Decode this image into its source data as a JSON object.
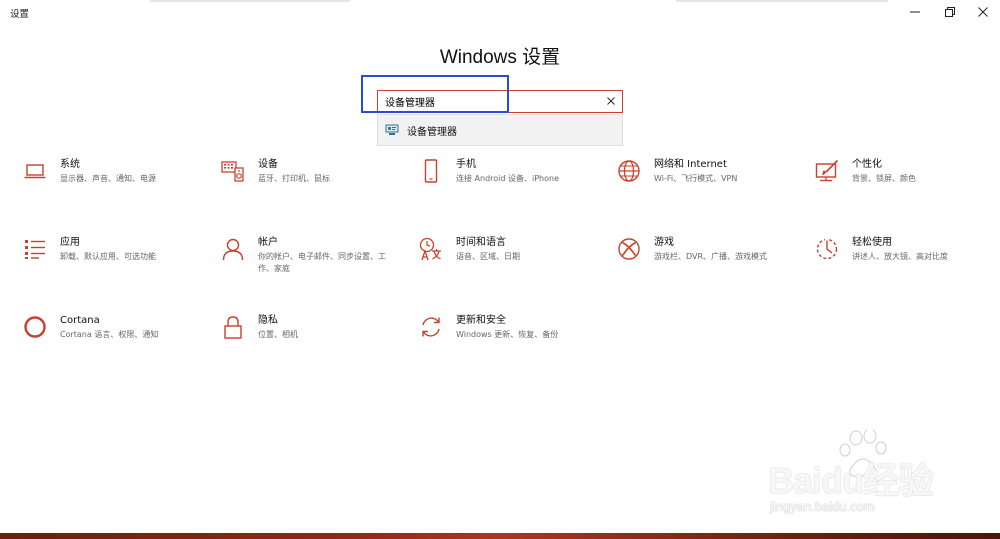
{
  "window": {
    "app_title": "设置",
    "controls": {
      "minimize": "minimize-icon",
      "maximize": "restore-icon",
      "close": "close-icon"
    }
  },
  "page_title": "Windows 设置",
  "search": {
    "value": "设备管理器",
    "placeholder": "",
    "clear_icon": "close-icon",
    "suggestion": {
      "label": "设备管理器",
      "icon": "device-manager-icon"
    }
  },
  "accent_color": "#c8412c",
  "focus_color": "#2b4bd6",
  "tiles": [
    {
      "name": "系统",
      "desc": "显示器、声音、通知、电源",
      "icon": "laptop-icon"
    },
    {
      "name": "设备",
      "desc": "蓝牙、打印机、鼠标",
      "icon": "keyboard-speaker-icon"
    },
    {
      "name": "手机",
      "desc": "连接 Android 设备、iPhone",
      "icon": "phone-icon"
    },
    {
      "name": "网络和 Internet",
      "desc": "Wi-Fi、飞行模式、VPN",
      "icon": "globe-icon"
    },
    {
      "name": "个性化",
      "desc": "背景、锁屏、颜色",
      "icon": "paint-monitor-icon"
    },
    {
      "name": "应用",
      "desc": "卸载、默认应用、可选功能",
      "icon": "app-list-icon"
    },
    {
      "name": "帐户",
      "desc": "你的帐户、电子邮件、同步设置、工作、家庭",
      "icon": "person-icon"
    },
    {
      "name": "时间和语言",
      "desc": "语音、区域、日期",
      "icon": "time-language-icon"
    },
    {
      "name": "游戏",
      "desc": "游戏栏、DVR、广播、游戏模式",
      "icon": "xbox-icon"
    },
    {
      "name": "轻松使用",
      "desc": "讲述人、放大镜、高对比度",
      "icon": "ease-of-access-icon"
    },
    {
      "name": "Cortana",
      "desc": "Cortana 语言、权限、通知",
      "icon": "cortana-icon"
    },
    {
      "name": "隐私",
      "desc": "位置、相机",
      "icon": "lock-icon"
    },
    {
      "name": "更新和安全",
      "desc": "Windows 更新、恢复、备份",
      "icon": "sync-icon"
    }
  ],
  "watermark": {
    "main": "Baidu经验",
    "sub": "jingyan.baidu.com"
  }
}
